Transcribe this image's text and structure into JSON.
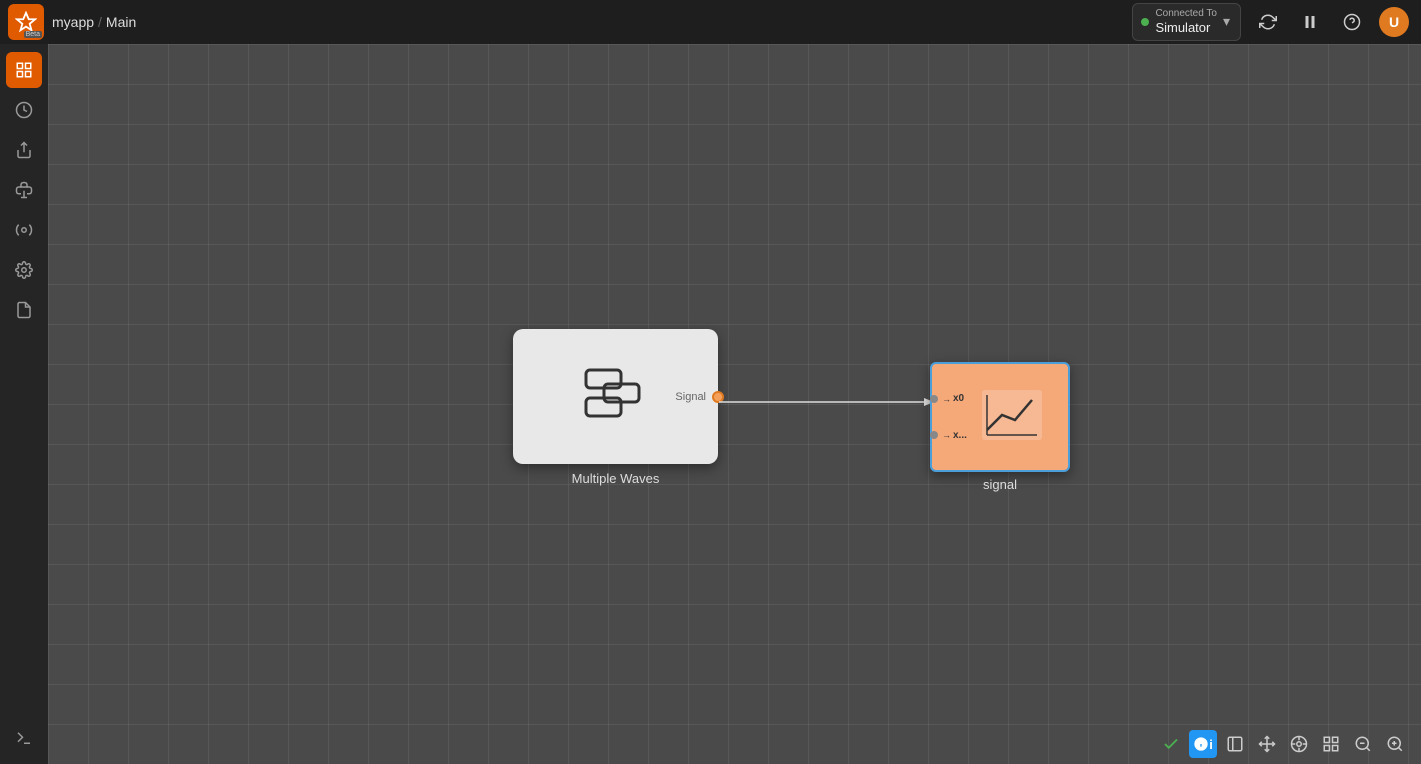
{
  "app": {
    "name": "myapp",
    "separator": "/",
    "page": "Main",
    "beta_label": "Beta"
  },
  "connection": {
    "connected_to": "Connected To",
    "simulator": "Simulator",
    "status": "connected",
    "status_color": "#4caf50"
  },
  "sidebar": {
    "items": [
      {
        "id": "grid",
        "label": "Grid",
        "active": true
      },
      {
        "id": "history",
        "label": "History",
        "active": false
      },
      {
        "id": "export",
        "label": "Export",
        "active": false
      },
      {
        "id": "python",
        "label": "Python",
        "active": false
      },
      {
        "id": "plugins",
        "label": "Plugins",
        "active": false
      },
      {
        "id": "settings",
        "label": "Settings",
        "active": false
      },
      {
        "id": "docs",
        "label": "Documentation",
        "active": false
      }
    ]
  },
  "nodes": {
    "multiple_waves": {
      "label": "Multiple Waves",
      "port_label": "Signal"
    },
    "signal": {
      "label": "signal",
      "input_ports": [
        "x0",
        "x..."
      ]
    }
  },
  "bottom_toolbar": {
    "tools": [
      "check",
      "info",
      "panel",
      "move",
      "target",
      "grid",
      "zoom-out",
      "zoom-in"
    ]
  }
}
